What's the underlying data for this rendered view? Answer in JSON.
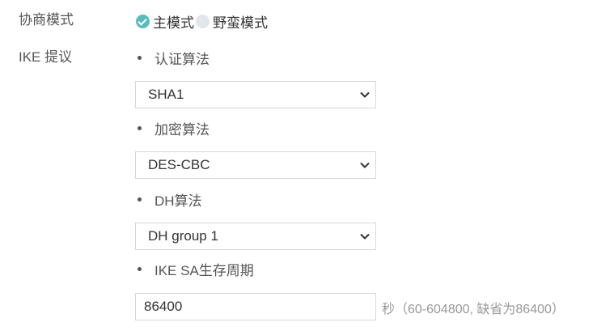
{
  "negotiation": {
    "label": "协商模式",
    "options": [
      {
        "label": "主模式",
        "checked": true
      },
      {
        "label": "野蛮模式",
        "checked": false
      }
    ]
  },
  "ike": {
    "label": "IKE 提议",
    "auth": {
      "label": "认证算法",
      "value": "SHA1"
    },
    "encrypt": {
      "label": "加密算法",
      "value": "DES-CBC"
    },
    "dh": {
      "label": "DH算法",
      "value": "DH group 1"
    },
    "lifetime": {
      "label": "IKE SA生存周期",
      "value": "86400",
      "hint": "秒（60-604800, 缺省为86400）"
    }
  },
  "colors": {
    "accent": "#5bbcbc",
    "border": "#d4d7dc",
    "hint": "#999999"
  }
}
